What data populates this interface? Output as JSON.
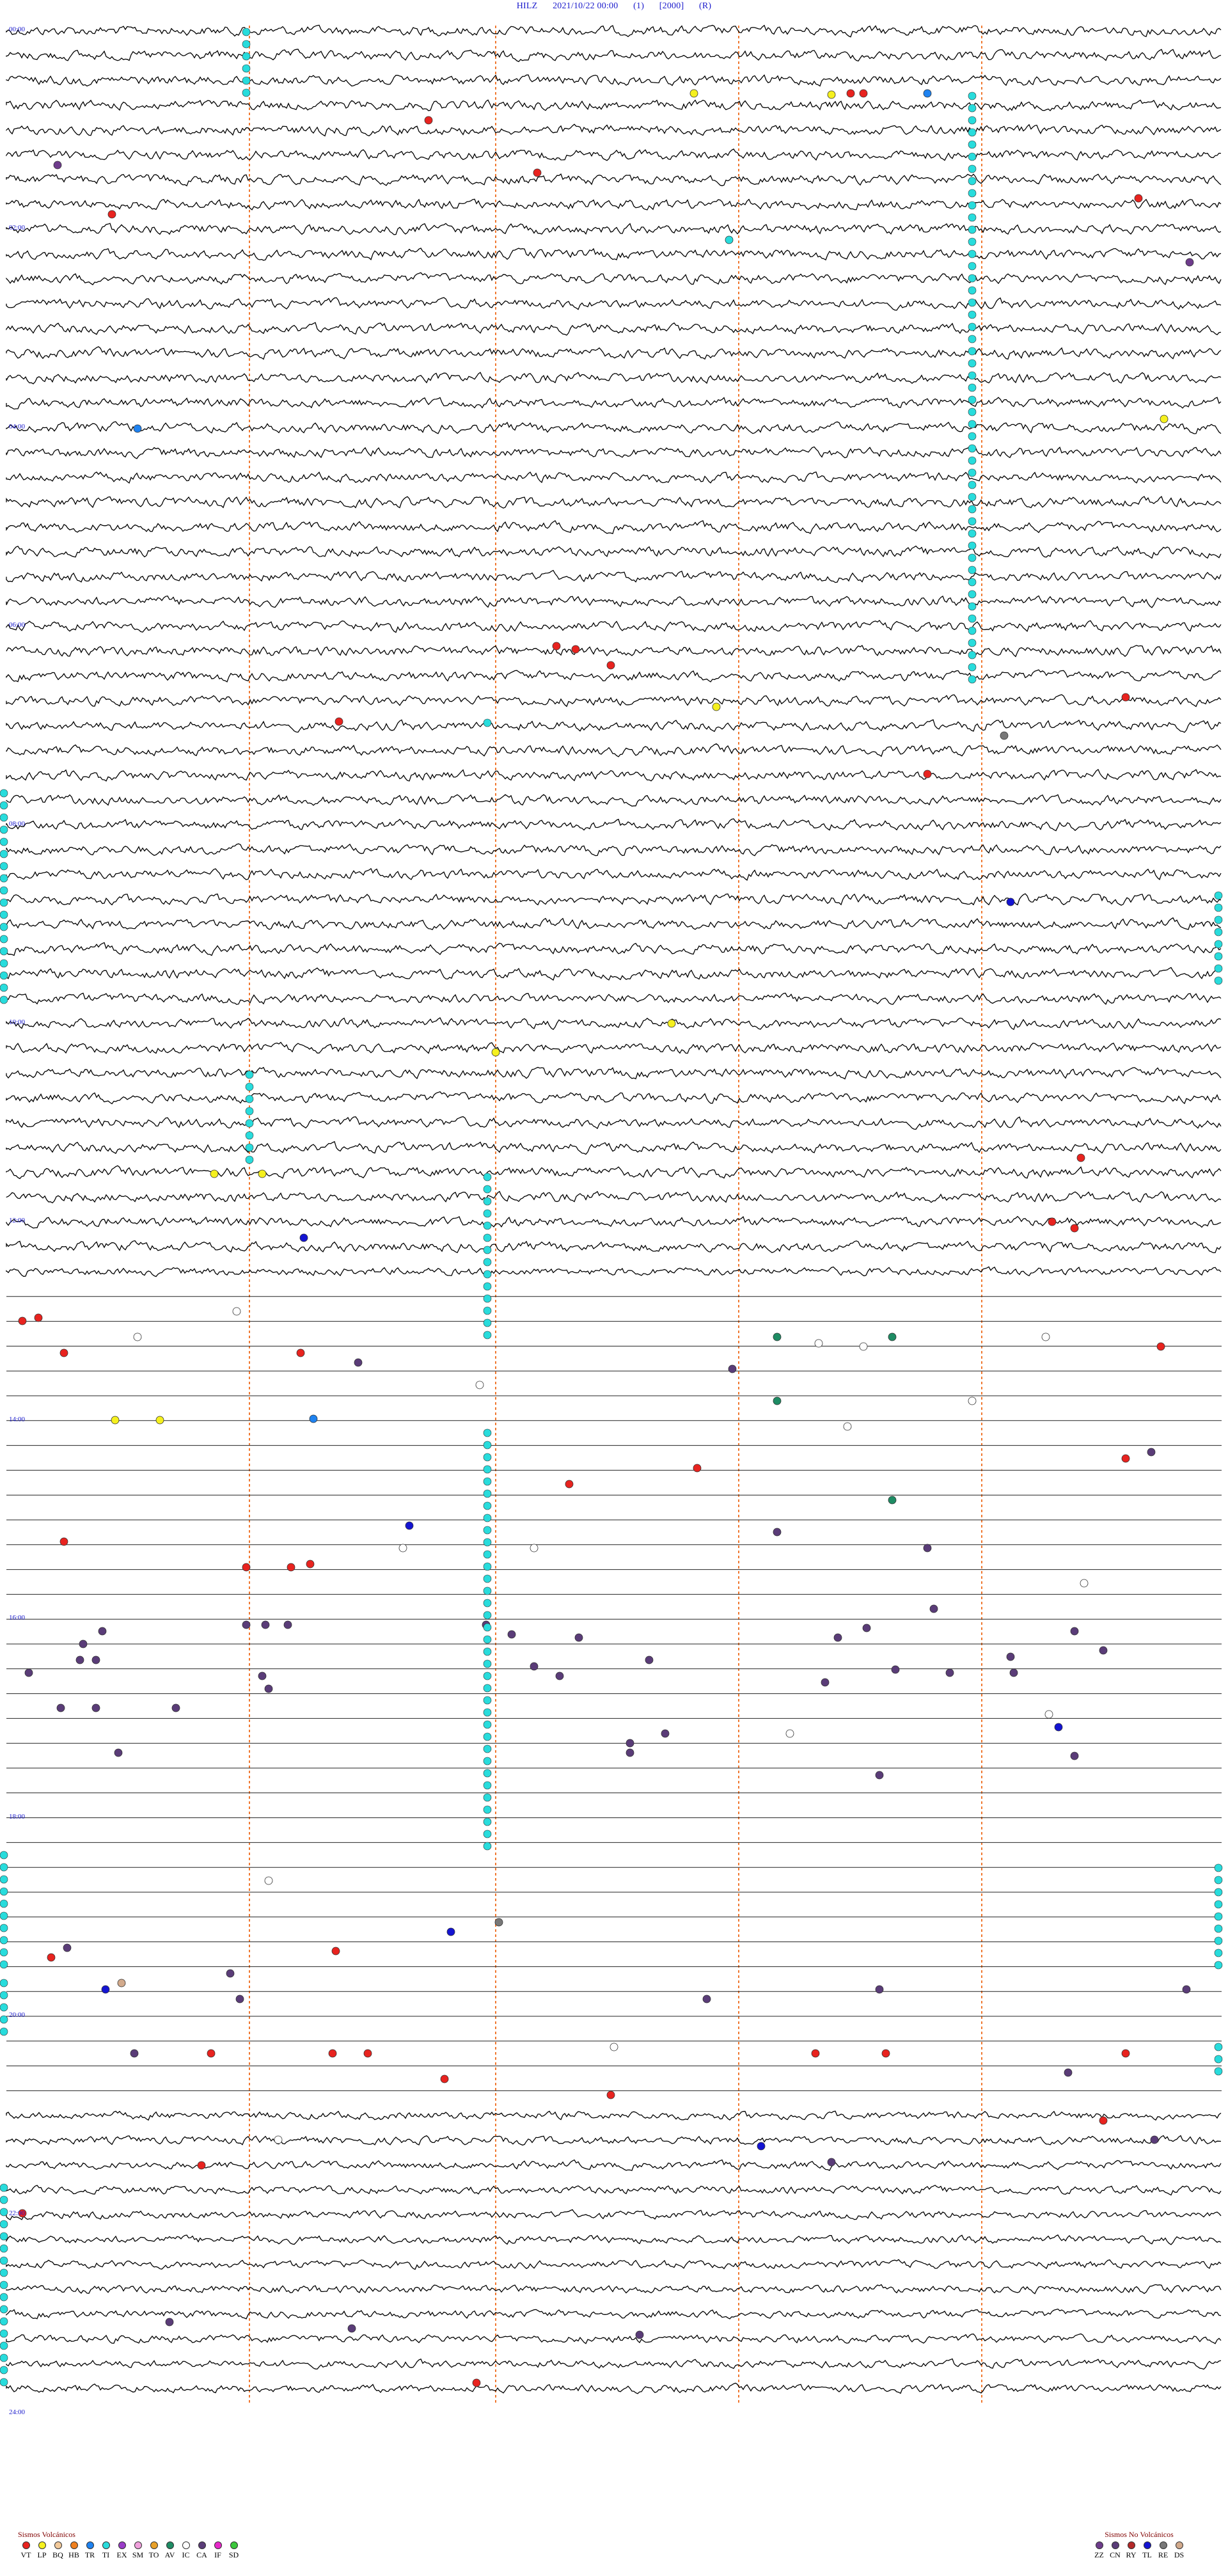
{
  "header": {
    "station": "HILZ",
    "datetime": "2021/10/22 00:00",
    "channel": "(1)",
    "scale": "[2000]",
    "flag": "(R)"
  },
  "chart_data": {
    "type": "helicorder",
    "hour_labels": [
      "00:00",
      "02:00",
      "04:00",
      "06:00",
      "08:00",
      "10:00",
      "12:00",
      "14:00",
      "16:00",
      "18:00",
      "20:00",
      "22:00",
      "24:00"
    ],
    "rows_per_hour": 4,
    "total_rows": 96,
    "grid": true
  },
  "legend": {
    "volcanic": {
      "title": "Sismos Volcánicos",
      "items": [
        {
          "code": "VT",
          "color": "#e8231f"
        },
        {
          "code": "LP",
          "color": "#f5f01e"
        },
        {
          "code": "BQ",
          "color": "#f2c99a"
        },
        {
          "code": "HB",
          "color": "#f0801e"
        },
        {
          "code": "TR",
          "color": "#1e82f0"
        },
        {
          "code": "TI",
          "color": "#28dcdc"
        },
        {
          "code": "EX",
          "color": "#9a3cc8"
        },
        {
          "code": "SM",
          "color": "#f0a0dc"
        },
        {
          "code": "TO",
          "color": "#e8a028"
        },
        {
          "code": "AV",
          "color": "#1e8c64"
        },
        {
          "code": "IC",
          "color": "#ffffff"
        },
        {
          "code": "CA",
          "color": "#5a3c78"
        },
        {
          "code": "IF",
          "color": "#e628c8"
        },
        {
          "code": "SD",
          "color": "#3cc83c"
        }
      ]
    },
    "non_volcanic": {
      "title": "Sismos No Volcánicos",
      "items": [
        {
          "code": "ZZ",
          "color": "#6e3c8c"
        },
        {
          "code": "CN",
          "color": "#5a3c78"
        },
        {
          "code": "RY",
          "color": "#b42828"
        },
        {
          "code": "TL",
          "color": "#1414d2"
        },
        {
          "code": "RE",
          "color": "#787878"
        },
        {
          "code": "DS",
          "color": "#d2aa8c"
        }
      ]
    }
  }
}
